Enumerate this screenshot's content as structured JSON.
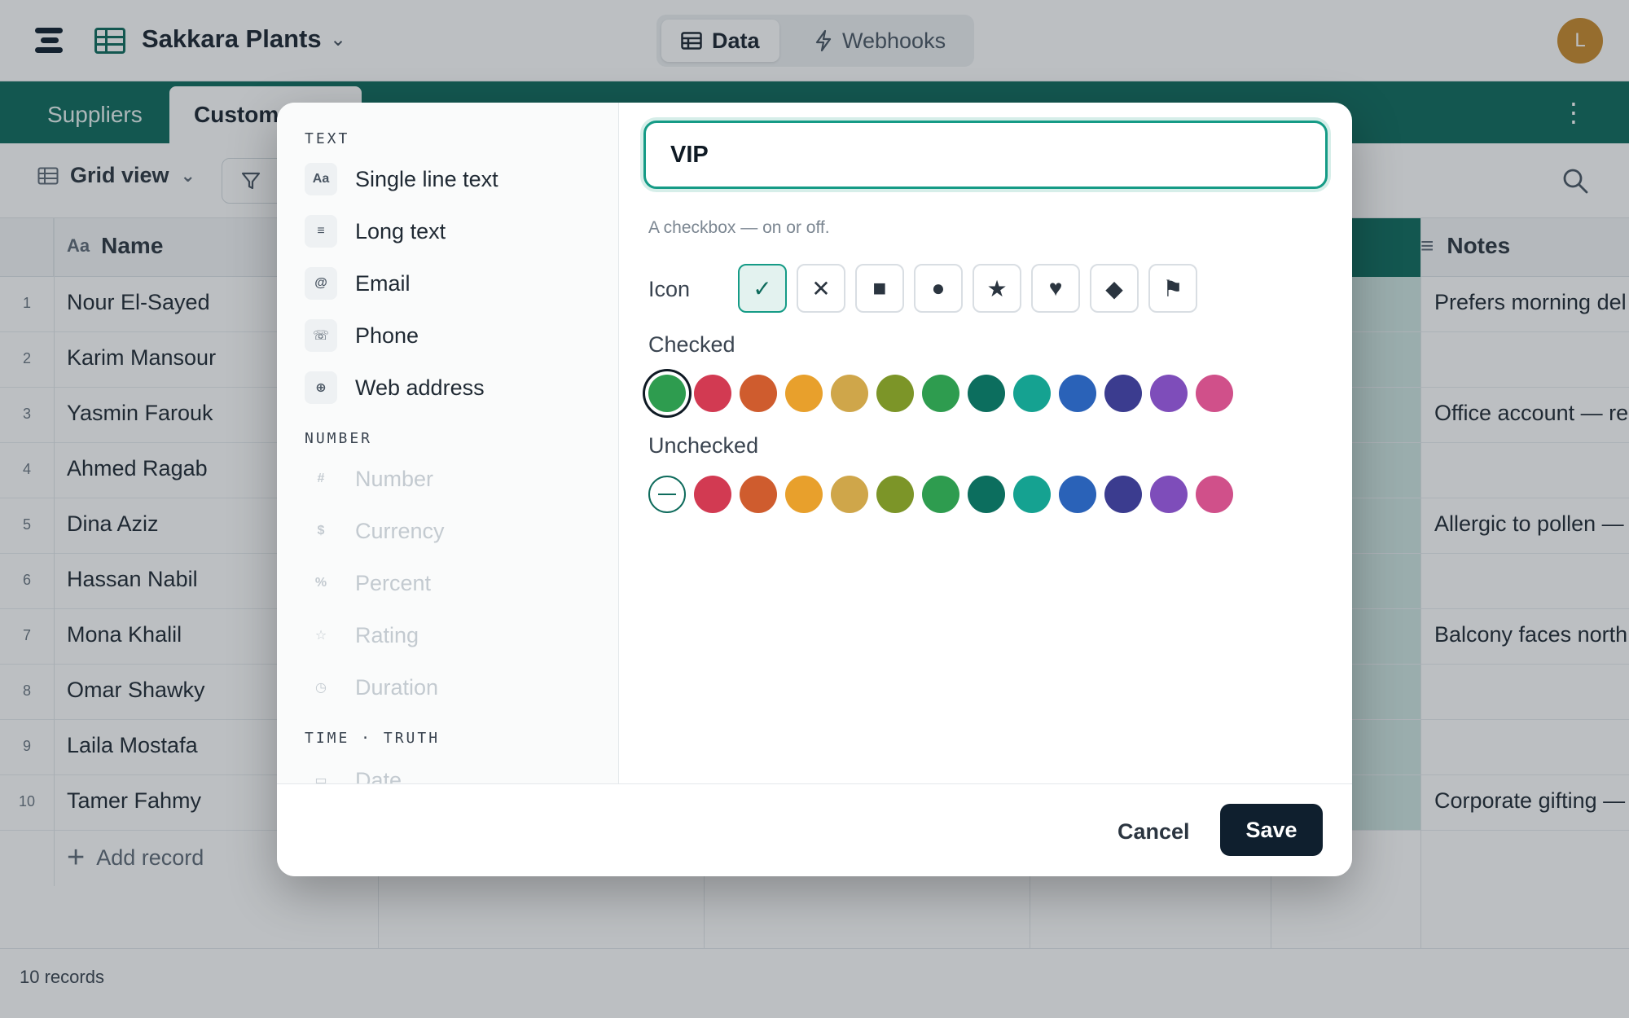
{
  "app": {
    "base_name": "Sakkara Plants",
    "avatar_initial": "L",
    "nav": {
      "data_label": "Data",
      "webhooks_label": "Webhooks"
    },
    "tabs": [
      {
        "label": "Suppliers"
      },
      {
        "label": "Custome"
      }
    ],
    "toolbar": {
      "view_label": "Grid view"
    },
    "grid": {
      "columns": {
        "name": "Name",
        "notes": "Notes"
      },
      "rows": [
        {
          "num": "1",
          "name": "Nour El-Sayed",
          "notes": "Prefers morning del"
        },
        {
          "num": "2",
          "name": "Karim Mansour",
          "notes": ""
        },
        {
          "num": "3",
          "name": "Yasmin Farouk",
          "notes": "Office account — re"
        },
        {
          "num": "4",
          "name": "Ahmed Ragab",
          "notes": ""
        },
        {
          "num": "5",
          "name": "Dina Aziz",
          "notes": "Allergic to pollen —"
        },
        {
          "num": "6",
          "name": "Hassan Nabil",
          "notes": ""
        },
        {
          "num": "7",
          "name": "Mona Khalil",
          "notes": "Balcony faces north"
        },
        {
          "num": "8",
          "name": "Omar Shawky",
          "notes": ""
        },
        {
          "num": "9",
          "name": "Laila Mostafa",
          "notes": ""
        },
        {
          "num": "10",
          "name": "Tamer Fahmy",
          "notes": "Corporate gifting —"
        }
      ],
      "add_record_label": "Add record"
    },
    "footer": {
      "records_count": "10 records"
    }
  },
  "modal": {
    "field_types": {
      "groups": [
        {
          "label": "TEXT"
        },
        {
          "label": "NUMBER"
        },
        {
          "label": "TIME · TRUTH"
        }
      ],
      "items": [
        {
          "icon": "Aa",
          "label": "Single line text"
        },
        {
          "icon": "≡",
          "label": "Long text"
        },
        {
          "icon": "@",
          "label": "Email"
        },
        {
          "icon": "☏",
          "label": "Phone"
        },
        {
          "icon": "⊕",
          "label": "Web address"
        },
        {
          "icon": "#",
          "label": "Number"
        },
        {
          "icon": "$",
          "label": "Currency"
        },
        {
          "icon": "%",
          "label": "Percent"
        },
        {
          "icon": "☆",
          "label": "Rating"
        },
        {
          "icon": "◷",
          "label": "Duration"
        },
        {
          "icon": "▭",
          "label": "Date"
        }
      ]
    },
    "config": {
      "field_name": "VIP",
      "description": "A checkbox — on or off.",
      "icon_label": "Icon",
      "icons": [
        {
          "glyph": "✓",
          "name": "check",
          "selected": true
        },
        {
          "glyph": "✕",
          "name": "cross"
        },
        {
          "glyph": "■",
          "name": "square"
        },
        {
          "glyph": "●",
          "name": "dot"
        },
        {
          "glyph": "★",
          "name": "star"
        },
        {
          "glyph": "♥",
          "name": "heart"
        },
        {
          "glyph": "◆",
          "name": "diamond"
        },
        {
          "glyph": "⚑",
          "name": "flag"
        }
      ],
      "checked_label": "Checked",
      "unchecked_label": "Unchecked",
      "colors": [
        "#2e9c4f",
        "#d23a52",
        "#cf5c2e",
        "#e8a02c",
        "#cfa64a",
        "#7c9528",
        "#2e9c4f",
        "#0c6e5e",
        "#15a291",
        "#2a62b8",
        "#3b3c8f",
        "#7e4dba",
        "#d0508a"
      ],
      "checked_selected_index": 0
    },
    "footer": {
      "cancel_label": "Cancel",
      "save_label": "Save"
    }
  }
}
